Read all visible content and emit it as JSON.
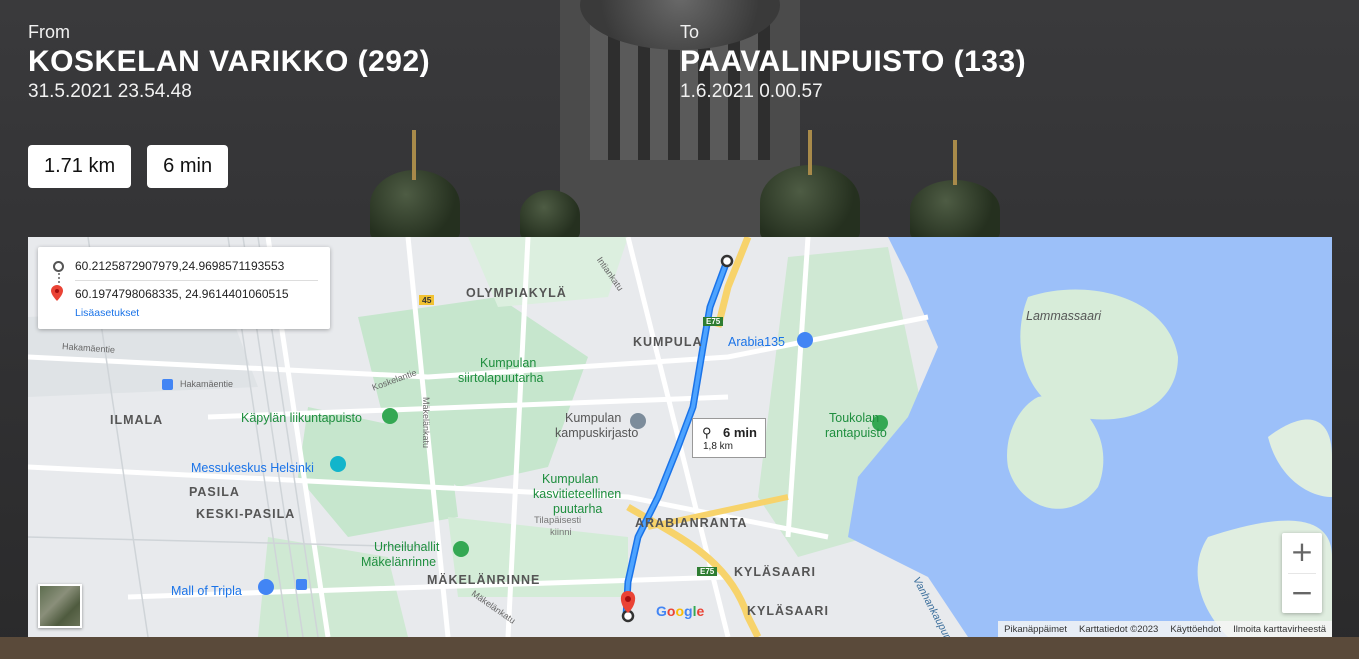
{
  "from": {
    "label": "From",
    "station": "KOSKELAN VARIKKO (292)",
    "time": "31.5.2021 23.54.48"
  },
  "to": {
    "label": "To",
    "station": "PAAVALINPUISTO (133)",
    "time": "1.6.2021 0.00.57"
  },
  "stats": {
    "distance": "1.71 km",
    "duration": "6 min"
  },
  "map": {
    "origin_coords": "60.2125872907979,24.9698571193553",
    "destination_coords": "60.1974798068335, 24.9614401060515",
    "more_options": "Lisäasetukset",
    "route_time": "6 min",
    "route_distance": "1,8 km",
    "labels": {
      "olympiakyla": "OLYMPIAKYLÄ",
      "kumpula": "KUMPULA",
      "arabia135": "Arabia135",
      "lammassaari": "Lammassaari",
      "kumpulan_siirtola": "Kumpulan",
      "kumpulan_siirtola2": "siirtolapuutarha",
      "kapylan": "Käpylän liikuntapuisto",
      "ilmala": "ILMALA",
      "kumpulan_kampus": "Kumpulan",
      "kumpulan_kampus2": "kampuskirjasto",
      "toukolan": "Toukolan",
      "toukolan2": "rantapuisto",
      "messukeskus": "Messukeskus Helsinki",
      "pasila": "PASILA",
      "keski_pasila": "KESKI-PASILA",
      "kasvit1": "Kumpulan",
      "kasvit2": "kasvitieteellinen",
      "kasvit3": "puutarha",
      "tilapaisesti1": "Tilapäisesti",
      "tilapaisesti2": "kiinni",
      "arabianranta": "ARABIANRANTA",
      "urheiluhallit1": "Urheiluhallit",
      "urheiluhallit2": "Mäkelänrinne",
      "makelanrinne": "MÄKELÄNRINNE",
      "kylasaari1": "KYLÄSAARI",
      "kylasaari2": "KYLÄSAARI",
      "mall": "Mall of Tripla",
      "vanhankaupunki": "Vanhankaupungi...",
      "hakamaentie1": "Hakamäentie",
      "hakamaentie2": "Hakamäentie",
      "koskelantie": "Koskelantie",
      "makelankatu": "Mäkelänkatu",
      "makelankatu2": "Mäkelänkatu",
      "intiankatu": "Intiankatu",
      "r45": "45",
      "e75a": "E75",
      "e75b": "E75",
      "google": "Google"
    },
    "attribution": [
      "Pikanäppäimet",
      "Karttatiedot ©2023",
      "Käyttöehdot",
      "Ilmoita karttavirheestä"
    ],
    "zoom_in": "+",
    "zoom_out": "−"
  }
}
